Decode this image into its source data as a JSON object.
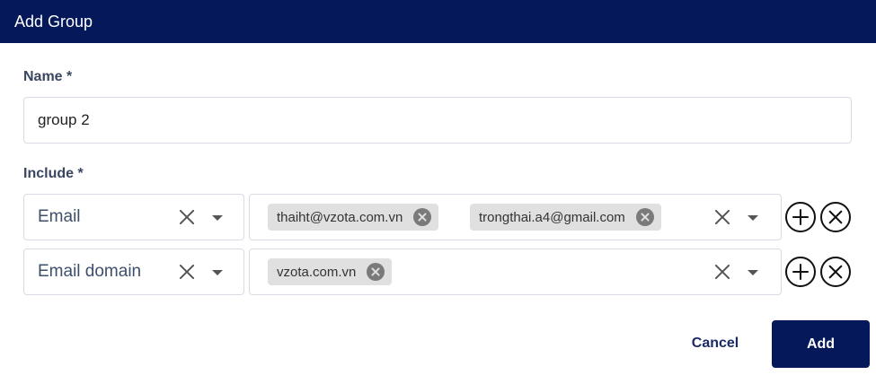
{
  "dialog": {
    "title": "Add Group"
  },
  "form": {
    "name_label": "Name *",
    "name_value": "group 2",
    "include_label": "Include *"
  },
  "rules": [
    {
      "type": "Email",
      "values": [
        "thaiht@vzota.com.vn",
        "trongthai.a4@gmail.com"
      ]
    },
    {
      "type": "Email domain",
      "values": [
        "vzota.com.vn"
      ]
    }
  ],
  "actions": {
    "cancel_label": "Cancel",
    "add_label": "Add"
  },
  "colors": {
    "header_bg": "#05195a",
    "primary_button": "#05195a",
    "cancel_text": "#1a2a66",
    "chip_bg": "#e0e0e0"
  },
  "icons": {
    "clear": "close-icon",
    "dropdown": "chevron-down-icon",
    "chip_remove": "circle-x-icon",
    "add_row": "circle-plus-icon",
    "remove_row": "circle-x-icon"
  }
}
